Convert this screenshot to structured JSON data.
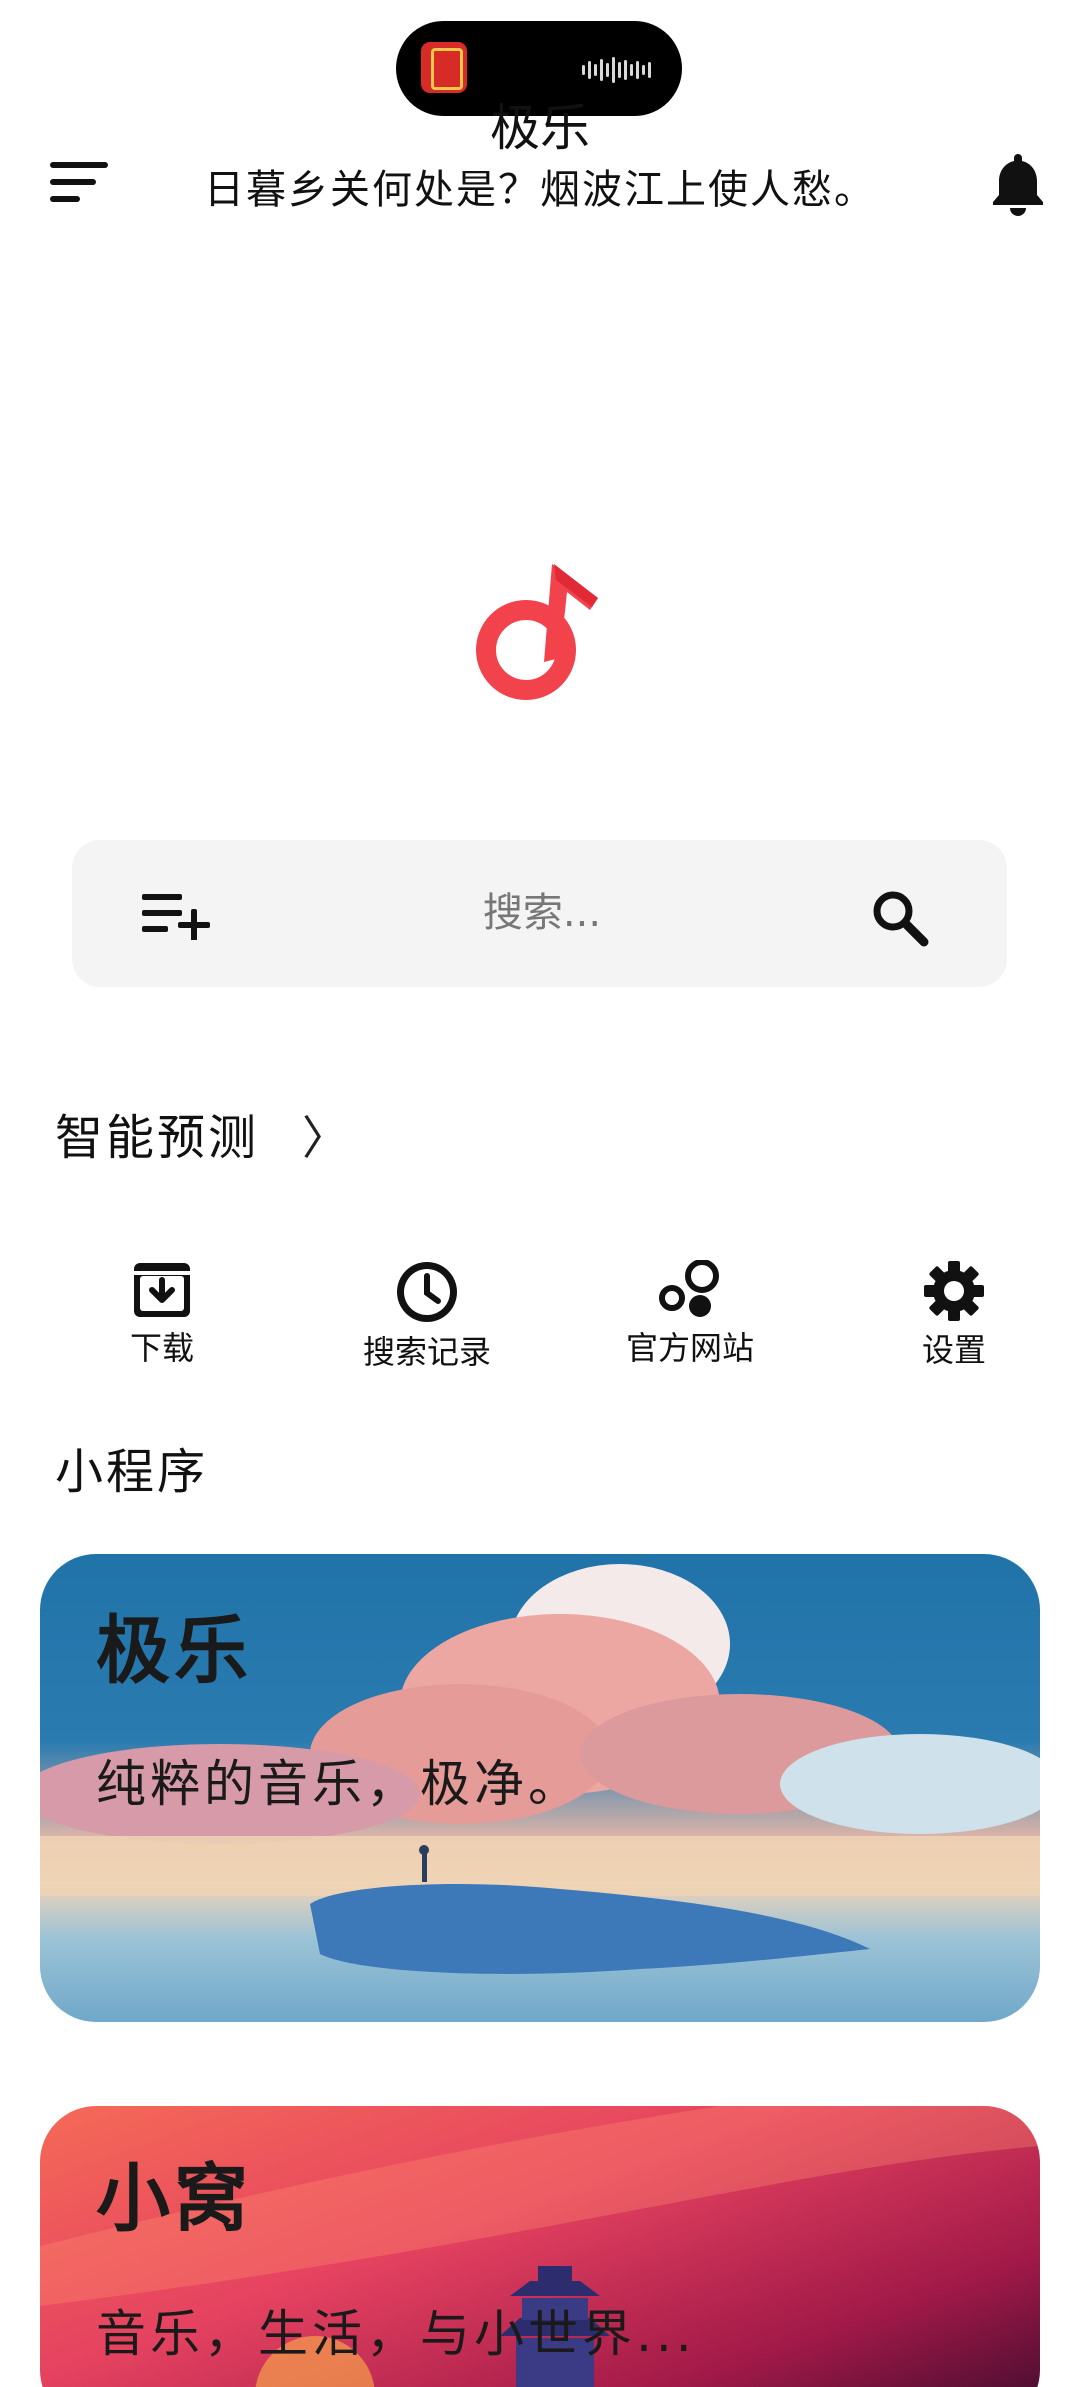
{
  "header": {
    "title": "极乐",
    "subtitle": "日暮乡关何处是？烟波江上使人愁。"
  },
  "search": {
    "placeholder": "搜索..."
  },
  "smart_predict": {
    "label": "智能预测",
    "chevron": "〉"
  },
  "quick_actions": [
    {
      "label": "下载",
      "icon": "download-box-icon"
    },
    {
      "label": "搜索记录",
      "icon": "history-clock-icon"
    },
    {
      "label": "官方网站",
      "icon": "bubbles-icon"
    },
    {
      "label": "设置",
      "icon": "gear-icon"
    }
  ],
  "mini_programs": {
    "heading": "小程序",
    "cards": [
      {
        "title": "极乐",
        "subtitle": "纯粹的音乐，极净。"
      },
      {
        "title": "小窝",
        "subtitle": "音乐，生活，与小世界..."
      }
    ]
  },
  "colors": {
    "brand": "#f2424c",
    "search_bg": "#f4f4f4"
  }
}
